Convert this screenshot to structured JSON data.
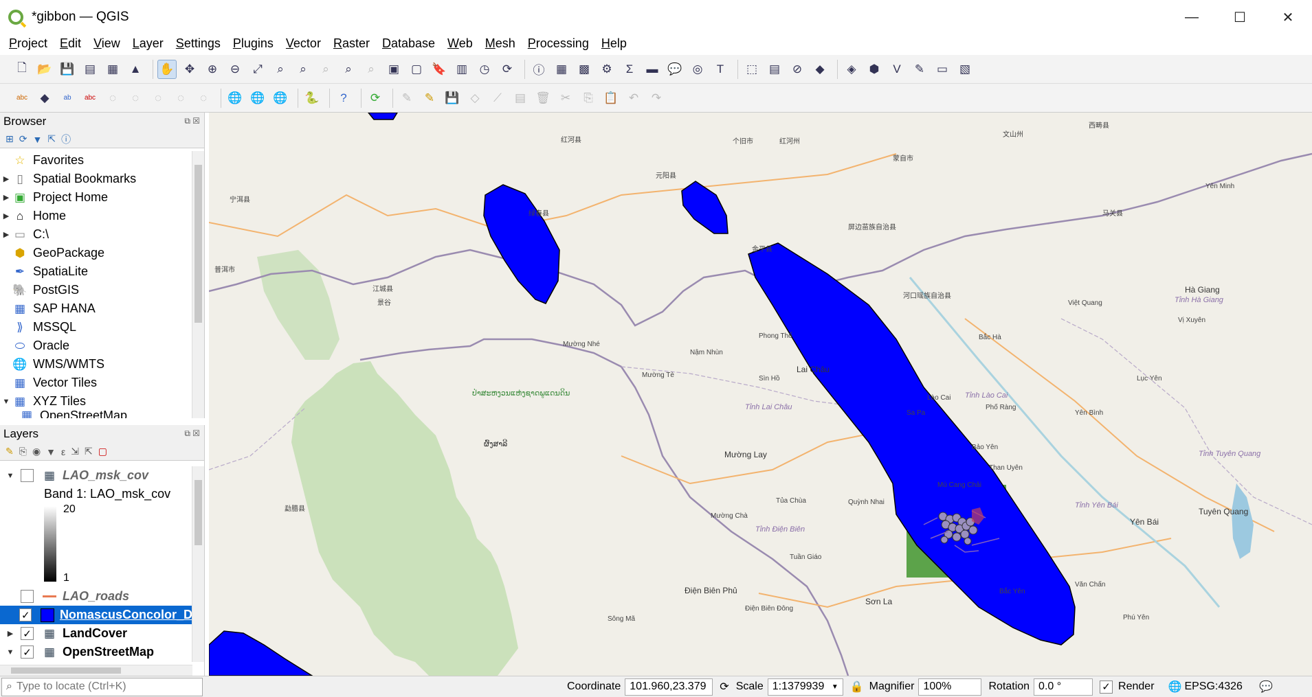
{
  "window": {
    "title": "*gibbon — QGIS",
    "minimize": "—",
    "maximize": "☐",
    "close": "✕"
  },
  "menu": [
    "Project",
    "Edit",
    "View",
    "Layer",
    "Settings",
    "Plugins",
    "Vector",
    "Raster",
    "Database",
    "Web",
    "Mesh",
    "Processing",
    "Help"
  ],
  "browser": {
    "title": "Browser",
    "items": [
      {
        "label": "Favorites",
        "icon": "star-icon"
      },
      {
        "label": "Spatial Bookmarks",
        "icon": "bookmark-icon"
      },
      {
        "label": "Project Home",
        "icon": "project-home-icon"
      },
      {
        "label": "Home",
        "icon": "home-icon"
      },
      {
        "label": "C:\\",
        "icon": "folder-icon"
      },
      {
        "label": "GeoPackage",
        "icon": "geopackage-icon"
      },
      {
        "label": "SpatiaLite",
        "icon": "feather-icon"
      },
      {
        "label": "PostGIS",
        "icon": "elephant-icon"
      },
      {
        "label": "SAP HANA",
        "icon": "database-icon"
      },
      {
        "label": "MSSQL",
        "icon": "mssql-icon"
      },
      {
        "label": "Oracle",
        "icon": "oracle-icon"
      },
      {
        "label": "WMS/WMTS",
        "icon": "globe-icon"
      },
      {
        "label": "Vector Tiles",
        "icon": "grid-icon"
      },
      {
        "label": "XYZ Tiles",
        "icon": "grid-icon"
      },
      {
        "label": "OpenStreetMap",
        "icon": "grid-icon"
      }
    ]
  },
  "layers": {
    "title": "Layers",
    "items": [
      {
        "label": "LAO_msk_cov",
        "checked": false
      },
      {
        "label": "Band 1: LAO_msk_cov"
      },
      {
        "label": "20"
      },
      {
        "label": "1"
      },
      {
        "label": "LAO_roads",
        "checked": false
      },
      {
        "label": "NomascusConcolor_D",
        "checked": true,
        "check_mark": "✓"
      },
      {
        "label": "LandCover",
        "checked": true,
        "check_mark": "✓"
      },
      {
        "label": "OpenStreetMap",
        "checked": true,
        "check_mark": "✓"
      }
    ]
  },
  "map": {
    "labels": [
      {
        "text": "普洱市"
      },
      {
        "text": "景谷"
      },
      {
        "text": "绿春县"
      },
      {
        "text": "红河县"
      },
      {
        "text": "元阳县"
      },
      {
        "text": "个旧市"
      },
      {
        "text": "红河州"
      },
      {
        "text": "蒙自市"
      },
      {
        "text": "文山州"
      },
      {
        "text": "西畴县"
      },
      {
        "text": "马关县"
      },
      {
        "text": "Lai Châu"
      },
      {
        "text": "Tỉnh Lai Châu"
      },
      {
        "text": "Mường Lay"
      },
      {
        "text": "Sìn Hồ"
      },
      {
        "text": "Phong Thổ"
      },
      {
        "text": "Mường Tè"
      },
      {
        "text": "Sa Pa"
      },
      {
        "text": "Lào Cai"
      },
      {
        "text": "Tỉnh Lào Cai"
      },
      {
        "text": "Bắc Hà"
      },
      {
        "text": "Hà Giang"
      },
      {
        "text": "Tỉnh Hà Giang"
      },
      {
        "text": "Vị Xuyên"
      },
      {
        "text": "Yên Minh"
      },
      {
        "text": "Bảo Yên"
      },
      {
        "text": "Phố Ràng"
      },
      {
        "text": "Yên Bái"
      },
      {
        "text": "Tỉnh Yên Bái"
      },
      {
        "text": "Tuyên Quang"
      },
      {
        "text": "Tỉnh Tuyên Quang"
      },
      {
        "text": "Quỳnh Nhai"
      },
      {
        "text": "Mường Chà"
      },
      {
        "text": "Tỉnh Điện Biên"
      },
      {
        "text": "Điện Biên Phủ"
      },
      {
        "text": "Điện Biên Đông"
      },
      {
        "text": "Tuần Giáo"
      },
      {
        "text": "Sơn La"
      },
      {
        "text": "Mường Nhé"
      },
      {
        "text": "Nậm Nhùn"
      },
      {
        "text": "Tủa Chùa"
      },
      {
        "text": "Than Uyên"
      },
      {
        "text": "Văn Chấn"
      },
      {
        "text": "Mù Cang Chải"
      },
      {
        "text": "Bắc Yên"
      },
      {
        "text": "Việt Quang"
      },
      {
        "text": "Yên Bình"
      },
      {
        "text": "Phú Yên"
      },
      {
        "text": "Sông Mã"
      },
      {
        "text": "Lục Yên"
      },
      {
        "text": "ຜົ້ງສາລີ"
      },
      {
        "text": "ປ່າສະຫງວນແຫ່ງຊາດພູແດນດິນ"
      },
      {
        "text": "江城县"
      },
      {
        "text": "金平县"
      },
      {
        "text": "河口瑶族自治县"
      },
      {
        "text": "屏边苗族自治县"
      },
      {
        "text": "勐腊县"
      },
      {
        "text": "宁洱县"
      }
    ],
    "polygon_fill": "#0000ff"
  },
  "status": {
    "locate_placeholder": "Type to locate (Ctrl+K)",
    "coordinate_label": "Coordinate",
    "coordinate_value": "101.960,23.379",
    "scale_label": "Scale",
    "scale_value": "1:1379939",
    "magnifier_label": "Magnifier",
    "magnifier_value": "100%",
    "rotation_label": "Rotation",
    "rotation_value": "0.0 °",
    "render_label": "Render",
    "crs": "EPSG:4326"
  }
}
